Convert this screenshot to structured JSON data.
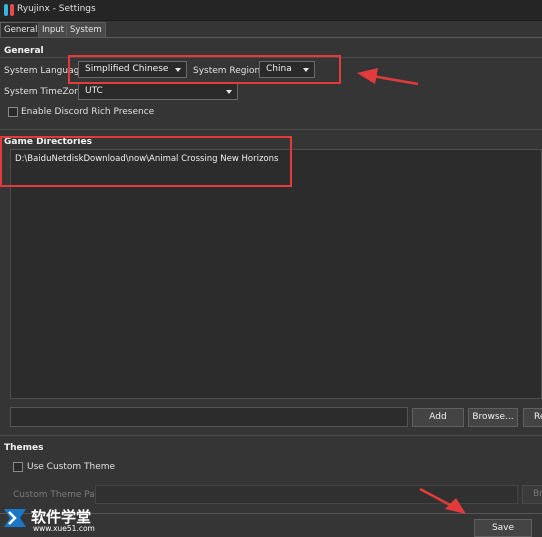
{
  "window": {
    "title": "Ryujinx - Settings"
  },
  "tabs": [
    {
      "label": "General",
      "active": true
    },
    {
      "label": "Input",
      "active": false
    },
    {
      "label": "System",
      "active": false
    }
  ],
  "general": {
    "heading": "General",
    "language_label": "System Language:",
    "language_value": "Simplified Chinese",
    "region_label": "System Region:",
    "region_value": "China",
    "timezone_label": "System TimeZone:",
    "timezone_value": "UTC",
    "discord_label": "Enable Discord Rich Presence",
    "discord_checked": false
  },
  "game_dirs": {
    "heading": "Game Directories",
    "items": [
      "D:\\BaiduNetdiskDownload\\now\\Animal Crossing New Horizons"
    ],
    "path_value": "",
    "add_label": "Add",
    "browse_label": "Browse...",
    "remove_label": "Re"
  },
  "themes": {
    "heading": "Themes",
    "custom_theme_label": "Use Custom Theme",
    "custom_theme_checked": false,
    "theme_path_label": "Custom Theme Path:",
    "theme_path_value": "",
    "browse_label": "Br"
  },
  "footer": {
    "save_label": "Save"
  },
  "watermark": {
    "brand": "软件学堂",
    "url": "www.xue51.com"
  },
  "colors": {
    "background": "#353535",
    "annotation": "#e33b3b",
    "icon_blue": "#2fb7e0",
    "icon_red": "#e84b4b"
  }
}
